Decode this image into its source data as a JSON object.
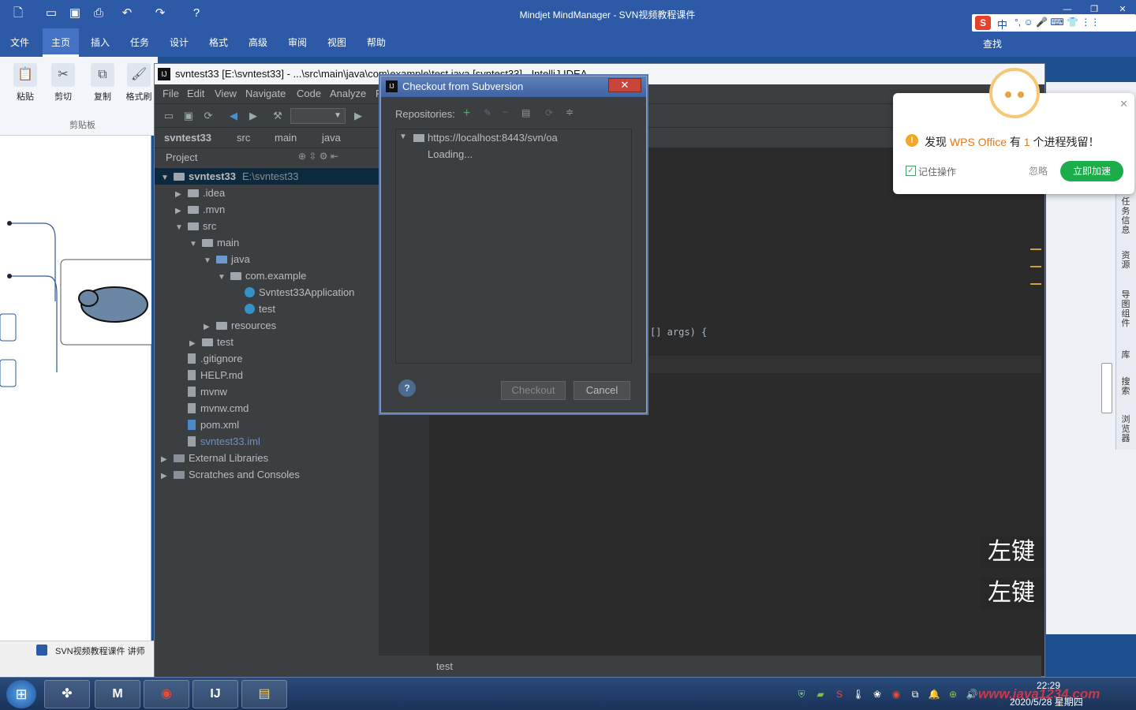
{
  "mindmanager": {
    "window_title": "Mindjet MindManager - SVN视频教程课件",
    "menu": [
      "文件",
      "主页",
      "插入",
      "任务",
      "设计",
      "格式",
      "高级",
      "审阅",
      "视图",
      "帮助"
    ],
    "active_menu": "主页",
    "ribbon": {
      "paste": "粘贴",
      "cut": "剪切",
      "copy": "复制",
      "format_painter": "格式刷",
      "group": "剪贴板"
    },
    "doc_tab": "SVN视频教程课件 讲师"
  },
  "ime": {
    "lang": "中",
    "find": "查找"
  },
  "idea": {
    "window_title": "svntest33 [E:\\svntest33] - ...\\src\\main\\java\\com\\example\\test.java [svntest33] - IntelliJ IDEA",
    "menu": [
      "File",
      "Edit",
      "View",
      "Navigate",
      "Code",
      "Analyze",
      "R"
    ],
    "breadcrumbs": [
      "svntest33",
      "src",
      "main",
      "java"
    ],
    "project_label": "Project",
    "tree": [
      {
        "label": "svntest33",
        "extra": "E:\\svntest33",
        "level": 0,
        "arrow": "▼",
        "type": "root"
      },
      {
        "label": ".idea",
        "level": 1,
        "arrow": "▶",
        "type": "folder"
      },
      {
        "label": ".mvn",
        "level": 1,
        "arrow": "▶",
        "type": "folder"
      },
      {
        "label": "src",
        "level": 1,
        "arrow": "▼",
        "type": "folder"
      },
      {
        "label": "main",
        "level": 2,
        "arrow": "▼",
        "type": "folder"
      },
      {
        "label": "java",
        "level": 3,
        "arrow": "▼",
        "type": "folder-blue"
      },
      {
        "label": "com.example",
        "level": 4,
        "arrow": "▼",
        "type": "package"
      },
      {
        "label": "Svntest33Application",
        "level": 5,
        "arrow": "",
        "type": "class"
      },
      {
        "label": "test",
        "level": 5,
        "arrow": "",
        "type": "class"
      },
      {
        "label": "resources",
        "level": 3,
        "arrow": "▶",
        "type": "folder"
      },
      {
        "label": "test",
        "level": 2,
        "arrow": "▶",
        "type": "folder"
      },
      {
        "label": ".gitignore",
        "level": 1,
        "arrow": "",
        "type": "file"
      },
      {
        "label": "HELP.md",
        "level": 1,
        "arrow": "",
        "type": "file"
      },
      {
        "label": "mvnw",
        "level": 1,
        "arrow": "",
        "type": "file"
      },
      {
        "label": "mvnw.cmd",
        "level": 1,
        "arrow": "",
        "type": "file"
      },
      {
        "label": "pom.xml",
        "level": 1,
        "arrow": "",
        "type": "maven"
      },
      {
        "label": "svntest33.iml",
        "level": 1,
        "arrow": "",
        "type": "file-iml"
      },
      {
        "label": "External Libraries",
        "level": 0,
        "arrow": "▶",
        "type": "lib"
      },
      {
        "label": "Scratches and Consoles",
        "level": 0,
        "arrow": "▶",
        "type": "lib"
      }
    ],
    "code_fragment": "[] args) {",
    "status_tab": "test"
  },
  "dialog": {
    "title": "Checkout from Subversion",
    "repositories_label": "Repositories:",
    "repo_url": "https://localhost:8443/svn/oa",
    "loading": "Loading...",
    "help": "?",
    "checkout": "Checkout",
    "cancel": "Cancel"
  },
  "wps_popup": {
    "prefix": "发现",
    "brand": "WPS Office",
    "middle": "有",
    "count": "1",
    "suffix": "个进程残留！",
    "remember": "记住操作",
    "ignore": "忽略",
    "accelerate": "立即加速"
  },
  "right_panel": {
    "tabs": [
      "任务信息",
      "资源",
      "导图组件",
      "库",
      "搜索",
      "浏览器"
    ]
  },
  "overlay": {
    "key_hint_1": "左键",
    "key_hint_2": "左键"
  },
  "taskbar": {
    "time": "22:29",
    "date": "2020/5/28 星期四",
    "watermark": "www.java1234.com"
  }
}
